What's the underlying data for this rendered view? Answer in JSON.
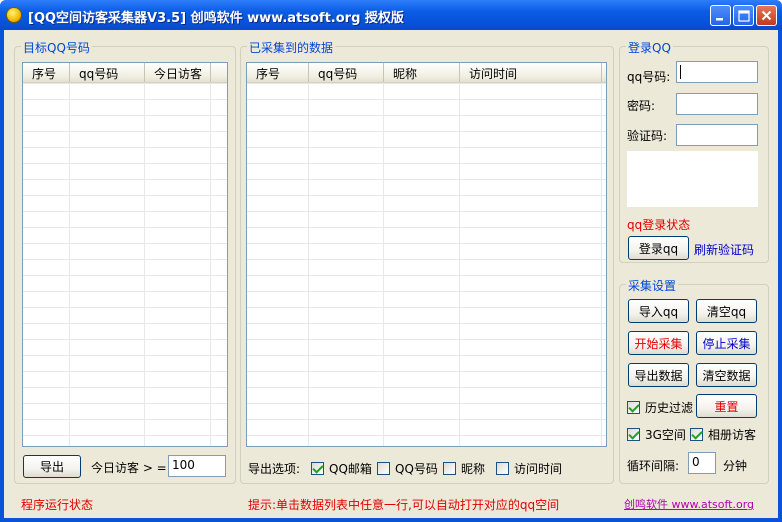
{
  "window": {
    "title": "[QQ空间访客采集器V3.5] 创鸣软件 www.atsoft.org 授权版",
    "minimize": "▁",
    "maximize": "□",
    "close": "✕"
  },
  "target_group": {
    "title": "目标QQ号码",
    "columns": [
      "序号",
      "qq号码",
      "今日访客"
    ],
    "import_button": "导出",
    "today_visitor_label": "今日访客 > =",
    "today_visitor_value": "100"
  },
  "collected_group": {
    "title": "已采集到的数据",
    "columns": [
      "序号",
      "qq号码",
      "昵称",
      "访问时间"
    ],
    "export_label": "导出选项:",
    "options": [
      {
        "label": "QQ邮箱",
        "checked": true
      },
      {
        "label": "QQ号码",
        "checked": false
      },
      {
        "label": "昵称",
        "checked": false
      },
      {
        "label": "访问时间",
        "checked": false
      }
    ]
  },
  "login_group": {
    "title": "登录QQ",
    "qq_label": "qq号码:",
    "qq_value": "",
    "password_label": "密码:",
    "password_value": "",
    "captcha_label": "验证码:",
    "captcha_value": "",
    "status": "qq登录状态",
    "login_button": "登录qq",
    "refresh_link": "刷新验证码"
  },
  "settings_group": {
    "title": "采集设置",
    "import_button": "导入qq",
    "clear_button": "清空qq",
    "start_button": "开始采集",
    "stop_button": "停止采集",
    "export_button": "导出数据",
    "clear_data_button": "清空数据",
    "history_filter": {
      "label": "历史过滤",
      "checked": true
    },
    "reset_button": "重置",
    "space_3g": {
      "label": "3G空间",
      "checked": true
    },
    "album_visitor": {
      "label": "相册访客",
      "checked": true
    },
    "interval_label": "循环间隔:",
    "interval_value": "0",
    "interval_unit": "分钟"
  },
  "footer": {
    "status": "程序运行状态",
    "hint": "提示:单击数据列表中任意一行,可以自动打开对应的qq空间",
    "link": "创鸣软件 www.atsoft.org"
  }
}
